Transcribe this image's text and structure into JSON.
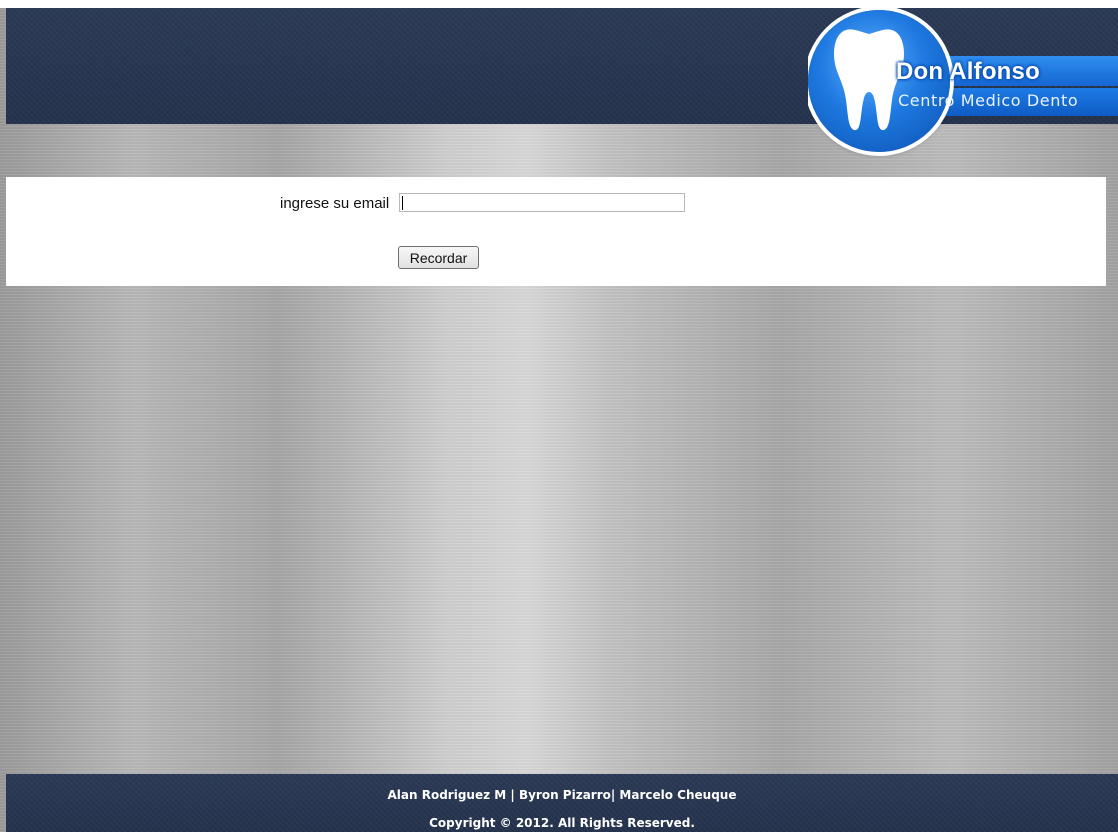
{
  "header": {
    "logo": {
      "title": "Don Alfonso",
      "subtitle": "Centro Medico Dento",
      "icon": "tooth-icon"
    }
  },
  "form": {
    "email_label": "ingrese su email",
    "email_value": "",
    "submit_label": "Recordar"
  },
  "footer": {
    "authors": "Alan Rodriguez M | Byron Pizarro| Marcelo Cheuque",
    "copyright": "Copyright © 2012. All Rights Reserved."
  },
  "colors": {
    "header_bg": "#2b3a56",
    "logo_blue": "#1e79e0",
    "panel_bg": "#ffffff"
  }
}
